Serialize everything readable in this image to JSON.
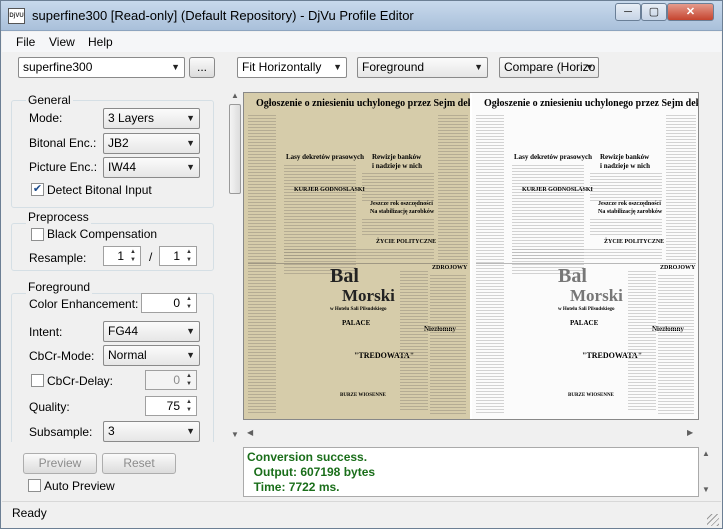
{
  "window": {
    "title": "superfine300 [Read-only] (Default Repository) - DjVu Profile Editor",
    "icon_label": "DjVU",
    "controls": {
      "minimize": "─",
      "maximize": "▢",
      "close": "✕"
    }
  },
  "menu": {
    "file": "File",
    "view": "View",
    "help": "Help"
  },
  "toolbar": {
    "profile": "superfine300",
    "browse": "...",
    "zoom": "Fit Horizontally",
    "layer": "Foreground",
    "compare": "Compare (Horizo"
  },
  "general": {
    "title": "General",
    "mode_label": "Mode:",
    "mode_value": "3 Layers",
    "bitonal_label": "Bitonal Enc.:",
    "bitonal_value": "JB2",
    "picture_label": "Picture Enc.:",
    "picture_value": "IW44",
    "detect_label": "Detect Bitonal Input",
    "detect_checked": true
  },
  "preprocess": {
    "title": "Preprocess",
    "black_label": "Black Compensation",
    "black_checked": false,
    "resample_label": "Resample:",
    "resample_a": "1",
    "resample_sep": "/",
    "resample_b": "1"
  },
  "foreground": {
    "title": "Foreground",
    "color_label": "Color Enhancement:",
    "color_value": "0",
    "intent_label": "Intent:",
    "intent_value": "FG44",
    "cbcr_label": "CbCr-Mode:",
    "cbcr_value": "Normal",
    "delay_label": "CbCr-Delay:",
    "delay_value": "0",
    "delay_checked": false,
    "quality_label": "Quality:",
    "quality_value": "75",
    "subsample_label": "Subsample:",
    "subsample_value": "3"
  },
  "actions": {
    "preview": "Preview",
    "reset": "Reset",
    "auto_preview": "Auto Preview",
    "auto_checked": false
  },
  "newspaper": {
    "headline": "Ogłoszenie o zniesieniu uchylonego przez Sejm dekret",
    "art1": "Lasy dekretów prasowych",
    "art2a": "Rewizje banków",
    "art2b": "i nadzieje w nich",
    "art3": "KURJER GODNOSLASKI",
    "art4a": "Jeszcze rok oszczędności",
    "art4b": "Na stabilizację zarobków",
    "art5": "ŻYCIE POLITYCZNE",
    "ad_big1": "Bal",
    "ad_big2": "Morski",
    "ad_sub": "w Hotelu Sali Pilsudskiego",
    "ad_palace": "PALACE",
    "ad_trad": "\"TREDOWATA\"",
    "ad_bottom": "BURZE WIOSENNE",
    "ad_right1": "ZDROJOWY",
    "ad_right2": "Niezłomny"
  },
  "console": {
    "line1": "Conversion success.",
    "line2": "  Output: 607198 bytes",
    "line3": "  Time: 7722 ms."
  },
  "status": "Ready"
}
